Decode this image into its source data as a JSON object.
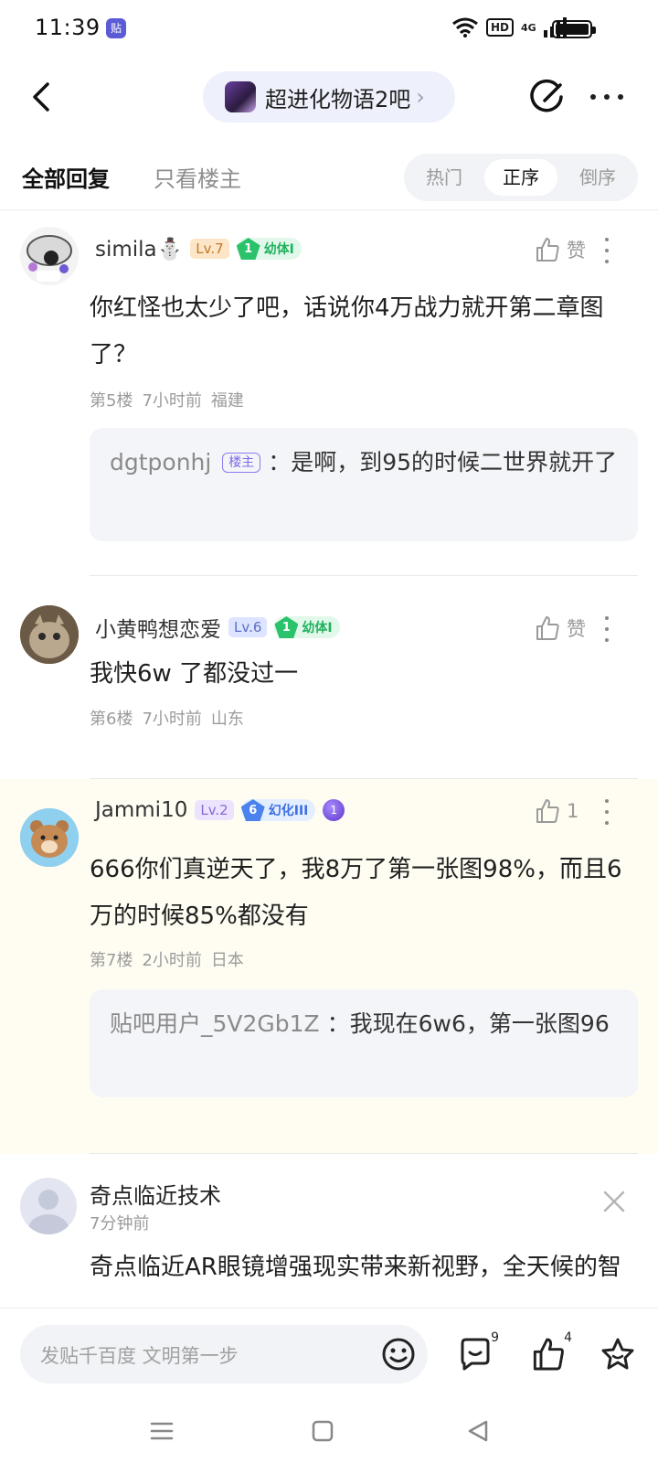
{
  "status_bar": {
    "time": "11:39",
    "app_icon": "贴",
    "hd": "HD",
    "network": "4G"
  },
  "header": {
    "forum_name": "超进化物语2吧",
    "back_icon": "chevron-left-icon",
    "edit_icon": "edit-icon",
    "more_icon": "more-icon"
  },
  "tabs": {
    "all_replies": "全部回复",
    "op_only": "只看楼主",
    "sort": {
      "hot": "热门",
      "asc": "正序",
      "desc": "倒序",
      "selected": "正序"
    }
  },
  "posts": [
    {
      "username": "simila⛄",
      "level": "Lv.7",
      "badge_num": "1",
      "badge_label": "幼体I",
      "like_label": "赞",
      "content": "你红怪也太少了吧，话说你4万战力就开第二章图了？",
      "floor": "第5楼",
      "time": "7小时前",
      "location": "福建",
      "reply": {
        "name": "dgtponhj",
        "tag": "楼主",
        "text": "：是啊，到95的时候二世界就开了"
      }
    },
    {
      "username": "小黄鸭想恋爱",
      "level": "Lv.6",
      "badge_num": "1",
      "badge_label": "幼体I",
      "like_label": "赞",
      "content": "我快6w 了都没过一",
      "floor": "第6楼",
      "time": "7小时前",
      "location": "山东"
    },
    {
      "username": "Jammi10",
      "level": "Lv.2",
      "badge_num": "6",
      "badge_label": "幻化III",
      "medal": "1",
      "like_label": "1",
      "content": "666你们真逆天了，我8万了第一张图98%，而且6万的时候85%都没有",
      "floor": "第7楼",
      "time": "2小时前",
      "location": "日本",
      "reply": {
        "name": "贴吧用户_5V2Gb1Z",
        "text": "：我现在6w6，第一张图96"
      }
    }
  ],
  "ad": {
    "title": "奇点临近技术",
    "time": "7分钟前",
    "text": "奇点临近AR眼镜增强现实带来新视野，全天候的智能眼镜"
  },
  "bottom_bar": {
    "input_placeholder": "发贴千百度 文明第一步",
    "comments_count": "9",
    "likes_count": "4"
  },
  "colors": {
    "accent": "#5b6fc5",
    "highlight_bg": "#fffdf2",
    "green_badge": "#20b15d"
  }
}
